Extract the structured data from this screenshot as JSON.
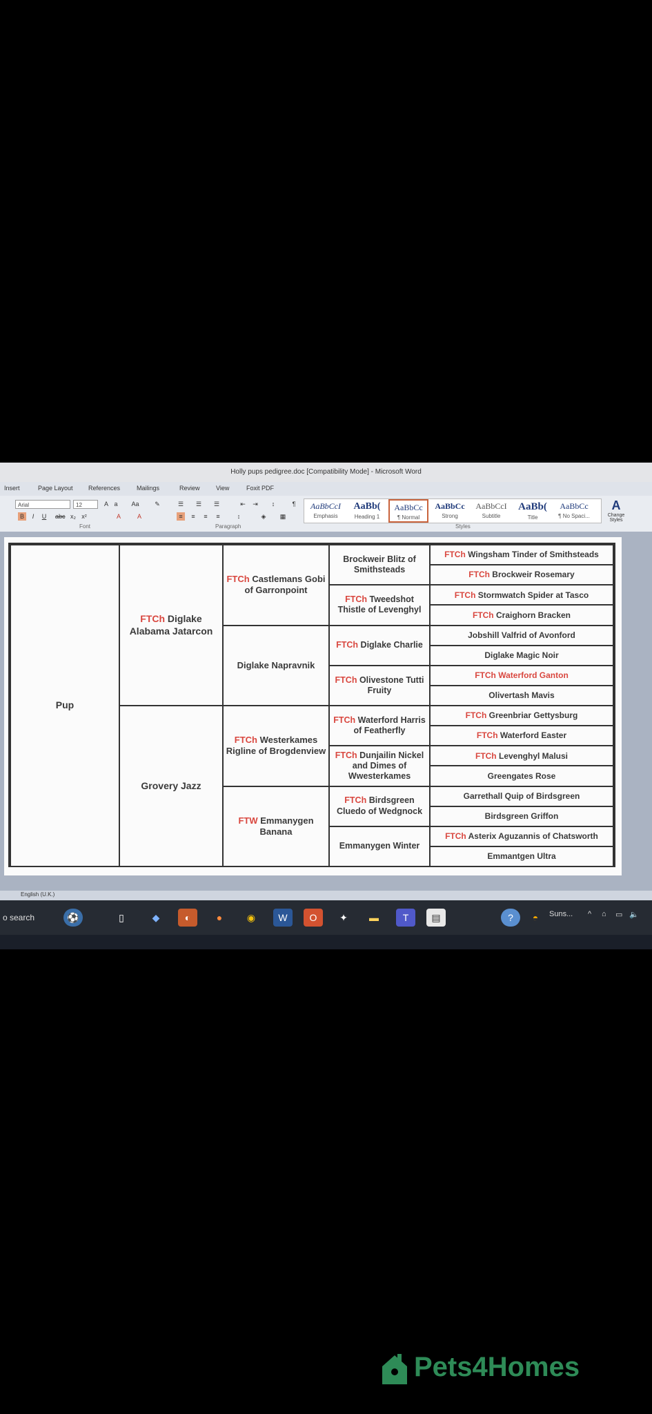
{
  "window": {
    "title": "Holly pups pedigree.doc [Compatibility Mode] - Microsoft Word"
  },
  "menu": [
    "Insert",
    "Page Layout",
    "References",
    "Mailings",
    "Review",
    "View",
    "Foxit PDF"
  ],
  "ribbon": {
    "font_name": "Arial",
    "font_size": "12",
    "group_font": "Font",
    "group_paragraph": "Paragraph",
    "group_styles": "Styles",
    "styles": [
      {
        "preview": "AaBbCcI",
        "name": "Emphasis"
      },
      {
        "preview": "AaBb(",
        "name": "Heading 1"
      },
      {
        "preview": "AaBbCc",
        "name": "¶ Normal",
        "selected": true
      },
      {
        "preview": "AaBbCc",
        "name": "Strong"
      },
      {
        "preview": "AaBbCcI",
        "name": "Subtitle"
      },
      {
        "preview": "AaBb(",
        "name": "Title"
      },
      {
        "preview": "AaBbCc",
        "name": "¶ No Spaci..."
      }
    ],
    "change_styles": "Change Styles"
  },
  "pedigree": {
    "pup": "Pup",
    "parents": [
      {
        "prefix": "FTCh",
        "name": "Diglake Alabama Jatarcon"
      },
      {
        "prefix": "",
        "name": "Grovery Jazz"
      }
    ],
    "grandparents": [
      {
        "prefix": "FTCh",
        "name": "Castlemans Gobi of Garronpoint"
      },
      {
        "prefix": "",
        "name": "Diglake Napravnik"
      },
      {
        "prefix": "FTCh",
        "name": "Westerkames Rigline of Brogdenview"
      },
      {
        "prefix": "FTW",
        "name": "Emmanygen Banana"
      }
    ],
    "great_grandparents": [
      {
        "prefix": "",
        "name": "Brockweir Blitz of Smithsteads"
      },
      {
        "prefix": "FTCh",
        "name": "Tweedshot Thistle of Levenghyl"
      },
      {
        "prefix": "FTCh",
        "name": "Diglake Charlie"
      },
      {
        "prefix": "FTCh",
        "name": "Olivestone Tutti Fruity"
      },
      {
        "prefix": "FTCh",
        "name": "Waterford Harris of Featherfly"
      },
      {
        "prefix": "FTCh",
        "name": "Dunjailin Nickel and Dimes of Wwesterkames"
      },
      {
        "prefix": "FTCh",
        "name": "Birdsgreen Cluedo of Wedgnock"
      },
      {
        "prefix": "",
        "name": "Emmanygen Winter"
      }
    ],
    "gg_grandparents": [
      {
        "prefix": "FTCh",
        "name": "Wingsham Tinder of Smithsteads"
      },
      {
        "prefix": "FTCh",
        "name": "Brockweir Rosemary"
      },
      {
        "prefix": "FTCh",
        "name": "Stormwatch Spider at Tasco"
      },
      {
        "prefix": "FTCh",
        "name": "Craighorn Bracken"
      },
      {
        "prefix": "",
        "name": "Jobshill Valfrid of Avonford"
      },
      {
        "prefix": "",
        "name": "Diglake Magic Noir"
      },
      {
        "prefix": "FTCh",
        "name": "Waterford Ganton"
      },
      {
        "prefix": "",
        "name": "Olivertash Mavis"
      },
      {
        "prefix": "FTCh",
        "name": "Greenbriar Gettysburg"
      },
      {
        "prefix": "FTCh",
        "name": "Waterford Easter"
      },
      {
        "prefix": "FTCh",
        "name": "Levenghyl Malusi"
      },
      {
        "prefix": "",
        "name": "Greengates Rose"
      },
      {
        "prefix": "",
        "name": "Garrethall Quip of Birdsgreen"
      },
      {
        "prefix": "",
        "name": "Birdsgreen Griffon"
      },
      {
        "prefix": "FTCh",
        "name": "Asterix Aguzannis of Chatsworth"
      },
      {
        "prefix": "",
        "name": "Emmantgen Ultra"
      }
    ]
  },
  "statusbar": {
    "language": "English (U.K.)"
  },
  "taskbar": {
    "search": "o search",
    "weather": "Suns..."
  },
  "watermark": {
    "text": "Pets4Homes"
  },
  "colors": {
    "title_prefix": "#d9473f",
    "text": "#3a3a3a",
    "brand": "#2e8b57"
  }
}
